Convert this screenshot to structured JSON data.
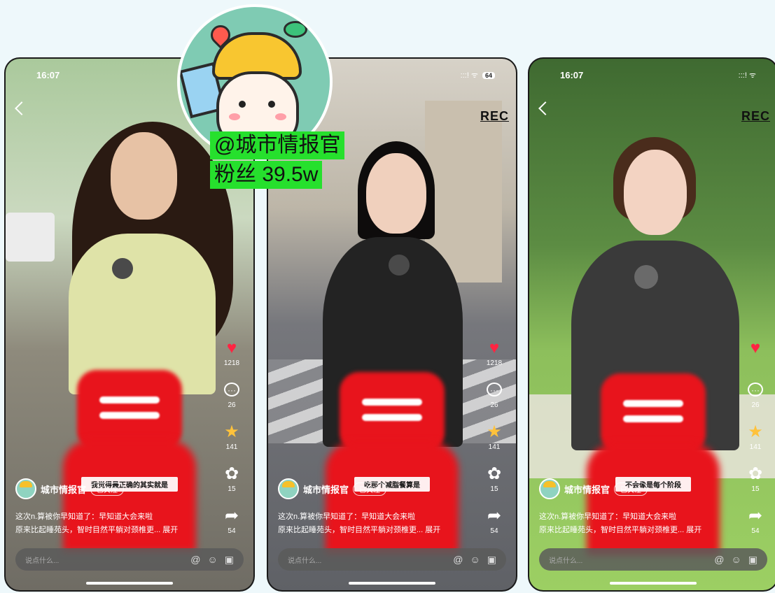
{
  "overlay": {
    "handle": "@城市情报官",
    "fans": "粉丝 39.5w"
  },
  "phones": [
    {
      "status_time": "16:07",
      "status_signal": "",
      "battery": "",
      "rec": "",
      "subtitle": "我觉得最正确的其实就是",
      "author_name": "城市情报官",
      "follow_label": "已关注",
      "caption_line1": "这次n.算被你早知道了：早知道大会来啦",
      "caption_line2": "原来比起睡苑头，智时目然平躺对颈椎更... 展开",
      "likes": "1218",
      "comments": "26",
      "stars": "141",
      "shares_wechat": "15",
      "forwards": "54",
      "comment_placeholder": "说点什么...",
      "colors": {
        "sky": "#b9d9b2",
        "ground": "#7d7a6f",
        "top": "#dfe3a8",
        "hair": "#2a1a12"
      }
    },
    {
      "status_time": "",
      "status_signal": ":::! ᯤ",
      "battery": "64",
      "rec": "REC",
      "subtitle": "吃那个减脂餐算是",
      "author_name": "城市情报官",
      "follow_label": "已关注",
      "caption_line1": "这次n.算被你早知道了：早知道大会来啦",
      "caption_line2": "原来比起睡苑头，智时目然平躺对颈椎更... 展开",
      "likes": "1218",
      "comments": "26",
      "stars": "141",
      "shares_wechat": "15",
      "forwards": "54",
      "comment_placeholder": "说点什么...",
      "colors": {
        "sky": "#c7c3bb",
        "ground": "#6d6e72",
        "top": "#232323",
        "hair": "#0e0c0c"
      }
    },
    {
      "status_time": "16:07",
      "status_signal": ":::! ᯤ",
      "battery": "",
      "rec": "REC",
      "subtitle": "不会像是每个阶段",
      "author_name": "城市情报官",
      "follow_label": "已关注",
      "caption_line1": "这次n.算被你早知道了：早知道大会来啦",
      "caption_line2": "原来比起睡苑头，智时目然平躺对颈椎更... 展开",
      "likes": "",
      "comments": "26",
      "stars": "141",
      "shares_wechat": "15",
      "forwards": "54",
      "comment_placeholder": "说点什么...",
      "colors": {
        "sky": "#4d7a3c",
        "ground": "#8cbf5a",
        "top": "#3a3a3a",
        "hair": "#4a2c1c"
      }
    }
  ],
  "icons": {
    "like": "heart-icon",
    "comment": "comment-icon",
    "star": "star-icon",
    "wechat": "wechat-icon",
    "share": "share-icon",
    "at": "at-icon",
    "emoji": "emoji-icon",
    "image": "image-icon"
  }
}
